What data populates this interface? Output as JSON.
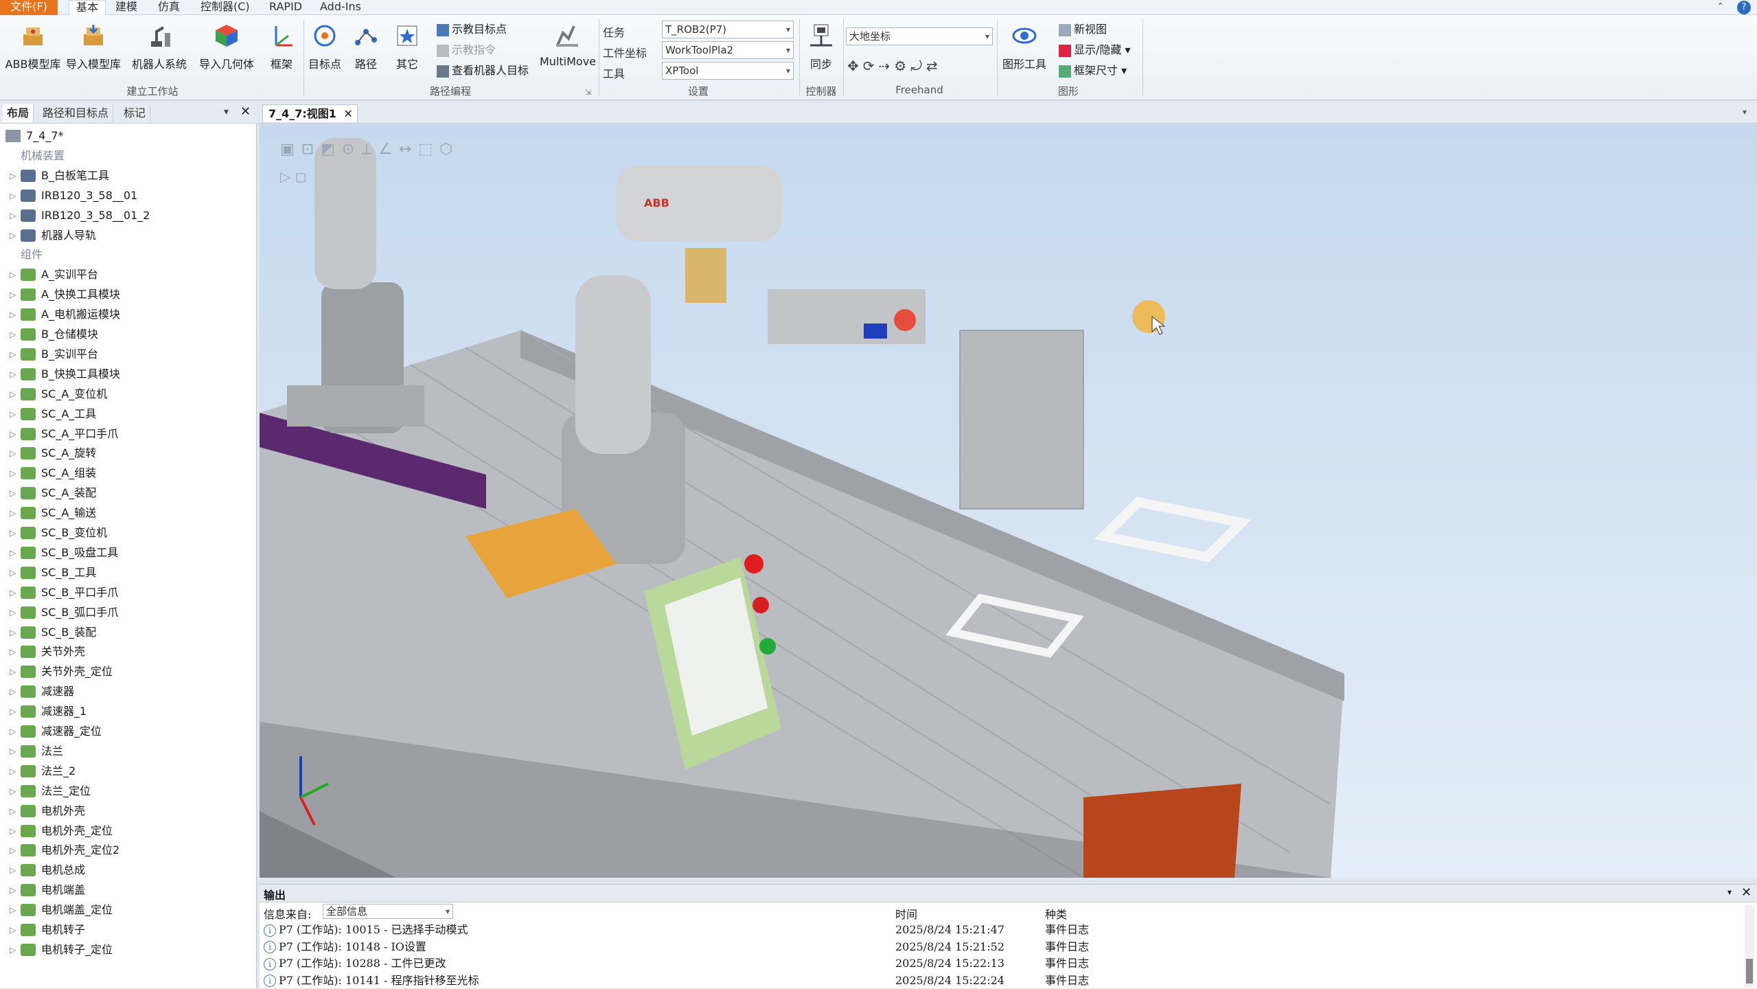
{
  "menu": {
    "file": "文件(F)",
    "items": [
      "基本",
      "建模",
      "仿真",
      "控制器(C)",
      "RAPID",
      "Add-Ins"
    ]
  },
  "ribbon": {
    "build_station": {
      "buttons": [
        "ABB模型库",
        "导入模型库",
        "机器人系统",
        "导入几何体",
        "框架"
      ],
      "label": "建立工作站"
    },
    "path_programming": {
      "buttons": [
        "目标点",
        "路径",
        "其它"
      ],
      "small": [
        "示教目标点",
        "示教指令",
        "查看机器人目标"
      ],
      "multimove": "MultiMove",
      "label": "路径编程"
    },
    "settings": {
      "task_label": "任务",
      "task_value": "T_ROB2(P7)",
      "wobj_label": "工件坐标",
      "wobj_value": "WorkToolPla2",
      "tool_label": "工具",
      "tool_value": "XPTool",
      "label": "设置"
    },
    "controller": {
      "button": "同步",
      "label": "控制器"
    },
    "freehand": {
      "coord_value": "大地坐标",
      "label": "Freehand"
    },
    "graphics": {
      "tools": "图形工具",
      "new_view": "新视图",
      "show_hide": "显示/隐藏",
      "frame_size": "框架尺寸",
      "label": "图形"
    }
  },
  "left_panel": {
    "tabs": [
      "布局",
      "路径和目标点",
      "标记"
    ],
    "station": "7_4_7*",
    "categories": {
      "mechanisms": "机械装置",
      "components": "组件"
    },
    "mechanisms": [
      "B_白板笔工具",
      "IRB120_3_58__01",
      "IRB120_3_58__01_2",
      "机器人导轨"
    ],
    "components": [
      "A_实训平台",
      "A_快换工具模块",
      "A_电机搬运模块",
      "B_仓储模块",
      "B_实训平台",
      "B_快换工具模块",
      "SC_A_变位机",
      "SC_A_工具",
      "SC_A_平口手爪",
      "SC_A_旋转",
      "SC_A_组装",
      "SC_A_装配",
      "SC_A_输送",
      "SC_B_变位机",
      "SC_B_吸盘工具",
      "SC_B_工具",
      "SC_B_平口手爪",
      "SC_B_弧口手爪",
      "SC_B_装配",
      "关节外壳",
      "关节外壳_定位",
      "减速器",
      "减速器_1",
      "减速器_定位",
      "法兰",
      "法兰_2",
      "法兰_定位",
      "电机外壳",
      "电机外壳_定位",
      "电机外壳_定位2",
      "电机总成",
      "电机端盖",
      "电机端盖_定位",
      "电机转子",
      "电机转子_定位"
    ]
  },
  "viewport": {
    "tab_title": "7_4_7:视图1"
  },
  "output": {
    "title": "输出",
    "source_label": "信息来自:",
    "source_value": "全部信息",
    "col_time": "时间",
    "col_type": "种类",
    "rows": [
      {
        "msg": "P7 (工作站): 10015 - 已选择手动模式",
        "time": "2025/8/24 15:21:47",
        "type": "事件日志"
      },
      {
        "msg": "P7 (工作站): 10148 - IO设置",
        "time": "2025/8/24 15:21:52",
        "type": "事件日志"
      },
      {
        "msg": "P7 (工作站): 10288 - 工件已更改",
        "time": "2025/8/24 15:22:13",
        "type": "事件日志"
      },
      {
        "msg": "P7 (工作站): 10141 - 程序指针移至光标",
        "time": "2025/8/24 15:22:24",
        "type": "事件日志"
      }
    ]
  },
  "colors": {
    "accent": "#e8731d",
    "ribbon_bg": "#eef3f9",
    "view_sky": "#c6d9ee"
  }
}
